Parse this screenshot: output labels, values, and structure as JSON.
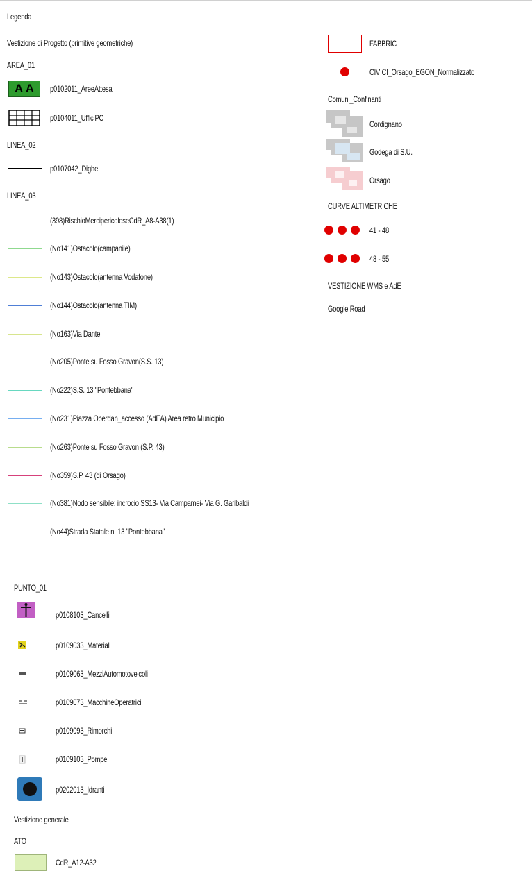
{
  "legend": {
    "title": "Legenda",
    "vestizione_progetto": "Vestizione di Progetto (primitive geometriche)",
    "area_01": {
      "header": "AREA_01",
      "items": [
        {
          "label": "p0102011_AreeAttesa",
          "symbol": "A A",
          "color": "#2e9b2e"
        },
        {
          "label": "p0104011_UfficiPC",
          "symbol": "grid"
        }
      ]
    },
    "linea_02": {
      "header": "LINEA_02",
      "items": [
        {
          "label": "p0107042_Dighe",
          "color": "#000000"
        }
      ]
    },
    "linea_03": {
      "header": "LINEA_03",
      "items": [
        {
          "label": "(398)RischioMercipericoloseCdR_A8-A38(1)",
          "color": "#b79be0"
        },
        {
          "label": "(No141)Ostacolo(campanile)",
          "color": "#8fd98f"
        },
        {
          "label": "(No143)Ostacolo(antenna Vodafone)",
          "color": "#dde88a"
        },
        {
          "label": "(No144)Ostacolo(antenna TIM)",
          "color": "#4f7fd6"
        },
        {
          "label": "(No163)Via Dante",
          "color": "#d7e58e"
        },
        {
          "label": "(No205)Ponte su Fosso Gravon(S.S. 13)",
          "color": "#a9dbe9"
        },
        {
          "label": "(No222)S.S. 13 \"Pontebbana\"",
          "color": "#67d8c0"
        },
        {
          "label": "(No231)Piazza Oberdan_accesso (AdEA) Area retro Municipio",
          "color": "#76aef0"
        },
        {
          "label": "(No263)Ponte su Fosso Gravon (S.P. 43)",
          "color": "#b8dc8c"
        },
        {
          "label": "(No359)S.P. 43 (di Orsago)",
          "color": "#d6417b"
        },
        {
          "label": "(No381)Nodo sensibile: incrocio SS13- Via Campamei- Via G. Garibaldi",
          "color": "#8fe0c7"
        },
        {
          "label": "(No44)Strada Statale n. 13 \"Pontebbana\"",
          "color": "#9a7fe8"
        }
      ]
    },
    "right": {
      "fabbric": {
        "label": "FABBRIC",
        "color": "#e00000"
      },
      "civici": {
        "label": "CIVICI_Orsago_EGON_Normalizzato",
        "color": "#e00000"
      },
      "comuni_header": "Comuni_Confinanti",
      "comuni": [
        {
          "label": "Cordignano",
          "color": "#c6c6c6"
        },
        {
          "label": "Godega di S.U.",
          "color": "#d7e6f2"
        },
        {
          "label": "Orsago",
          "color": "#f6cdd0"
        }
      ],
      "curve_header": "CURVE ALTIMETRICHE",
      "curve": [
        {
          "label": "41 - 48",
          "color": "#e00000"
        },
        {
          "label": "48 - 55",
          "color": "#e00000"
        }
      ],
      "vestizione_wms": "VESTIZIONE WMS e AdE",
      "google_road": "Google Road"
    },
    "punto_01": {
      "header": "PUNTO_01",
      "items": [
        {
          "label": "p0108103_Cancelli",
          "icon": "cross-icon",
          "color": "#c25fc4"
        },
        {
          "label": "p0109033_Materiali",
          "icon": "materials-icon",
          "color": "#e2d21c"
        },
        {
          "label": "p0109063_MezziAutomotoveicoli",
          "icon": "vehicle-icon"
        },
        {
          "label": "p0109073_MacchineOperatrici",
          "icon": "machine-icon"
        },
        {
          "label": "p0109093_Rimorchi",
          "icon": "trailer-icon"
        },
        {
          "label": "p0109103_Pompe",
          "icon": "pump-icon"
        },
        {
          "label": "p0202013_Idranti",
          "icon": "hydrant-icon",
          "color": "#2f7ab8"
        }
      ]
    },
    "vestizione_generale": "Vestizione generale",
    "ato": {
      "header": "ATO",
      "items": [
        {
          "label": "CdR_A12-A32",
          "color": "#ddf0b8"
        }
      ]
    }
  }
}
